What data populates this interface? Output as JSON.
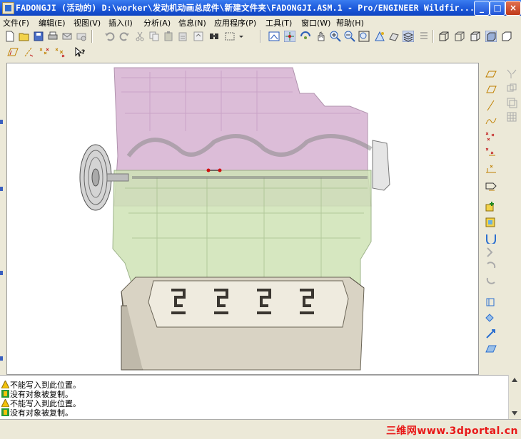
{
  "window": {
    "title": "FADONGJI (活动的) D:\\worker\\发动机动画总成件\\新建文件夹\\FADONGJI.ASM.1 - Pro/ENGINEER Wildfir...",
    "controls": {
      "minimize": "_",
      "maximize": "□",
      "close": "×"
    }
  },
  "menu": [
    {
      "label": "文件(F)"
    },
    {
      "label": "编辑(E)"
    },
    {
      "label": "视图(V)"
    },
    {
      "label": "插入(I)"
    },
    {
      "label": "分析(A)"
    },
    {
      "label": "信息(N)"
    },
    {
      "label": "应用程序(P)"
    },
    {
      "label": "工具(T)"
    },
    {
      "label": "窗口(W)"
    },
    {
      "label": "帮助(H)"
    }
  ],
  "toolbar": {
    "row1_icons": [
      "new-file-icon",
      "open-folder-icon",
      "save-icon",
      "print-icon",
      "email-icon",
      "email-attach-icon",
      "undo-icon",
      "redo-icon",
      "cut-icon",
      "copy-icon",
      "paste-icon",
      "paste-special-icon",
      "regenerate-icon",
      "find-icon",
      "select-box-icon",
      "repaint-icon",
      "spin-center-icon",
      "orient-mode-icon",
      "zoom-in-icon",
      "zoom-out-icon",
      "refit-icon",
      "reorient-icon",
      "saved-views-icon",
      "layers-icon",
      "wireframe-icon",
      "hidden-line-icon",
      "no-hidden-icon",
      "shading-icon",
      "datum-icon"
    ],
    "row2_icons": [
      "datum-plane-display-icon",
      "datum-axis-display-icon",
      "datum-point-display-icon",
      "coord-sys-display-icon",
      "context-help-icon"
    ]
  },
  "right_toolbar_icons": [
    "datum-plane-icon",
    "datum-axis-icon",
    "datum-curve-icon",
    "sketched-curve-icon",
    "datum-point-icon",
    "offset-point-icon",
    "coord-system-icon",
    "analysis-icon",
    "add-component-icon",
    "create-component-icon",
    "package-icon",
    "assembly-pattern-icon",
    "mirror-icon",
    "merge-icon",
    "cutout-icon",
    "restructure-icon",
    "repeat-icon",
    "flexible-icon",
    "shrinkwrap-icon"
  ],
  "messages": [
    {
      "icon": "warning-icon",
      "text": "不能写入到此位置。"
    },
    {
      "icon": "info-icon",
      "text": "没有对象被复制。"
    },
    {
      "icon": "warning-icon",
      "text": "不能写入到此位置。"
    },
    {
      "icon": "info-icon",
      "text": "没有对象被复制。"
    }
  ],
  "watermark": "三维网www.3dportal.cn",
  "colors": {
    "title_bar": "#1a56d8",
    "head_pink": "#d9b6d4",
    "block_green": "#cfe3b6",
    "oil_pan": "#d9d3c4",
    "watermark": "#e81818"
  }
}
